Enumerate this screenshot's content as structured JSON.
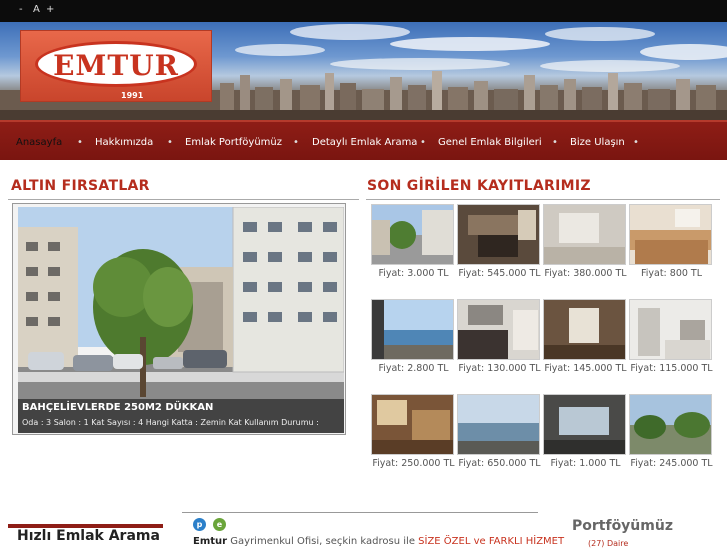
{
  "topbar": {
    "minus": "-",
    "reset": "A",
    "plus": "+"
  },
  "logo": {
    "text": "EMTUR",
    "year": "1991"
  },
  "nav": {
    "items": [
      {
        "label": "Anasayfa"
      },
      {
        "label": "Hakkımızda"
      },
      {
        "label": "Emlak Portföyümüz"
      },
      {
        "label": "Detaylı Emlak Arama"
      },
      {
        "label": "Genel Emlak Bilgileri"
      },
      {
        "label": "Bize Ulaşın"
      }
    ],
    "separator": "•"
  },
  "altin": {
    "title": "ALTIN FIRSATLAR",
    "feature_title": "BAHÇELİEVLERDE 250M2 DÜKKAN",
    "feature_desc": "Oda : 3 Salon : 1 Kat Sayısı : 4 Hangi Katta : Zemin Kat Kullanım Durumu :"
  },
  "son": {
    "title": "SON GİRİLEN KAYITLARIMIZ",
    "listings": [
      {
        "price": "Fiyat:  3.000  TL"
      },
      {
        "price": "Fiyat:  545.000 TL"
      },
      {
        "price": "Fiyat:  380.000 TL"
      },
      {
        "price": "Fiyat:  800 TL"
      },
      {
        "price": "Fiyat:  2.800  TL"
      },
      {
        "price": "Fiyat:  130.000 TL"
      },
      {
        "price": "Fiyat:  145.000 TL"
      },
      {
        "price": "Fiyat:  115.000 TL"
      },
      {
        "price": "Fiyat:  250.000 TL"
      },
      {
        "price": "Fiyat:  650.000 TL"
      },
      {
        "price": "Fiyat:  1.000 TL"
      },
      {
        "price": "Fiyat:  245.000 TL"
      }
    ]
  },
  "bottom": {
    "search_title": "Hızlı Emlak Arama",
    "intro_brand": "Emtur",
    "intro_text": " Gayrimenkul Ofisi, seçkin kadrosu ile ",
    "intro_highlight": "SİZE ÖZEL ve FARKLI HİZMET",
    "portfolio_title": "Portföyümüz",
    "portfolio_sub": "(27) Daire"
  },
  "colors": {
    "brand": "#8e1d16",
    "accent": "#b52d1e"
  }
}
